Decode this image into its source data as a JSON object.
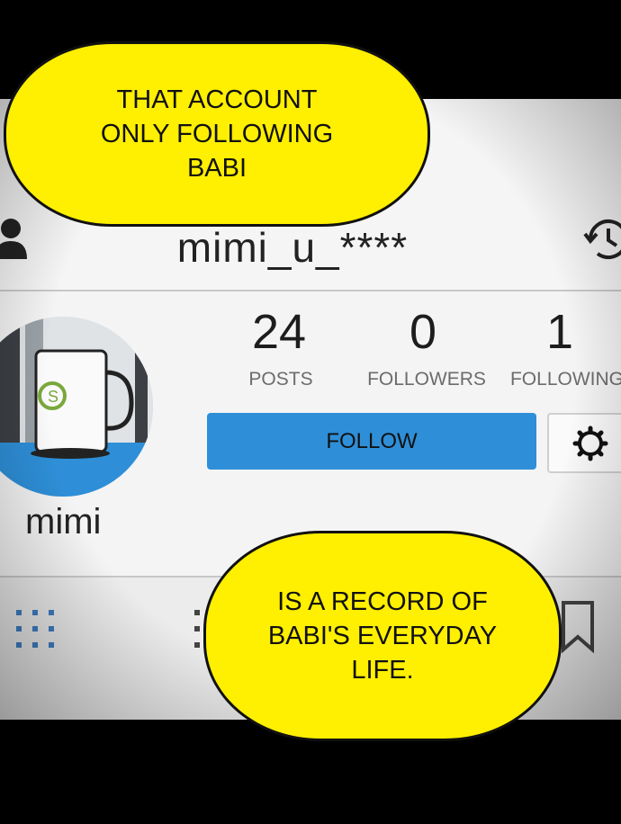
{
  "profile": {
    "username": "mimi_u_****",
    "display_name": "mimi",
    "stats": [
      {
        "number": "24",
        "label": "POSTS"
      },
      {
        "number": "0",
        "label": "FOLLOWERS"
      },
      {
        "number": "1",
        "label": "FOLLOWING"
      }
    ],
    "follow_label": "FOLLOW",
    "icons": {
      "person": "person-icon",
      "history": "history-icon",
      "settings": "gear-icon",
      "grid": "grid-icon",
      "list": "list-icon",
      "bookmark": "bookmark-icon"
    }
  },
  "captions": {
    "top": "THAT ACCOUNT\nONLY FOLLOWING\nBABI",
    "bottom": "IS A RECORD OF\nBABI'S EVERYDAY\nLIFE."
  },
  "colors": {
    "bubble": "#ffef00",
    "follow_button": "#2e8fd8",
    "background": "#000000"
  }
}
